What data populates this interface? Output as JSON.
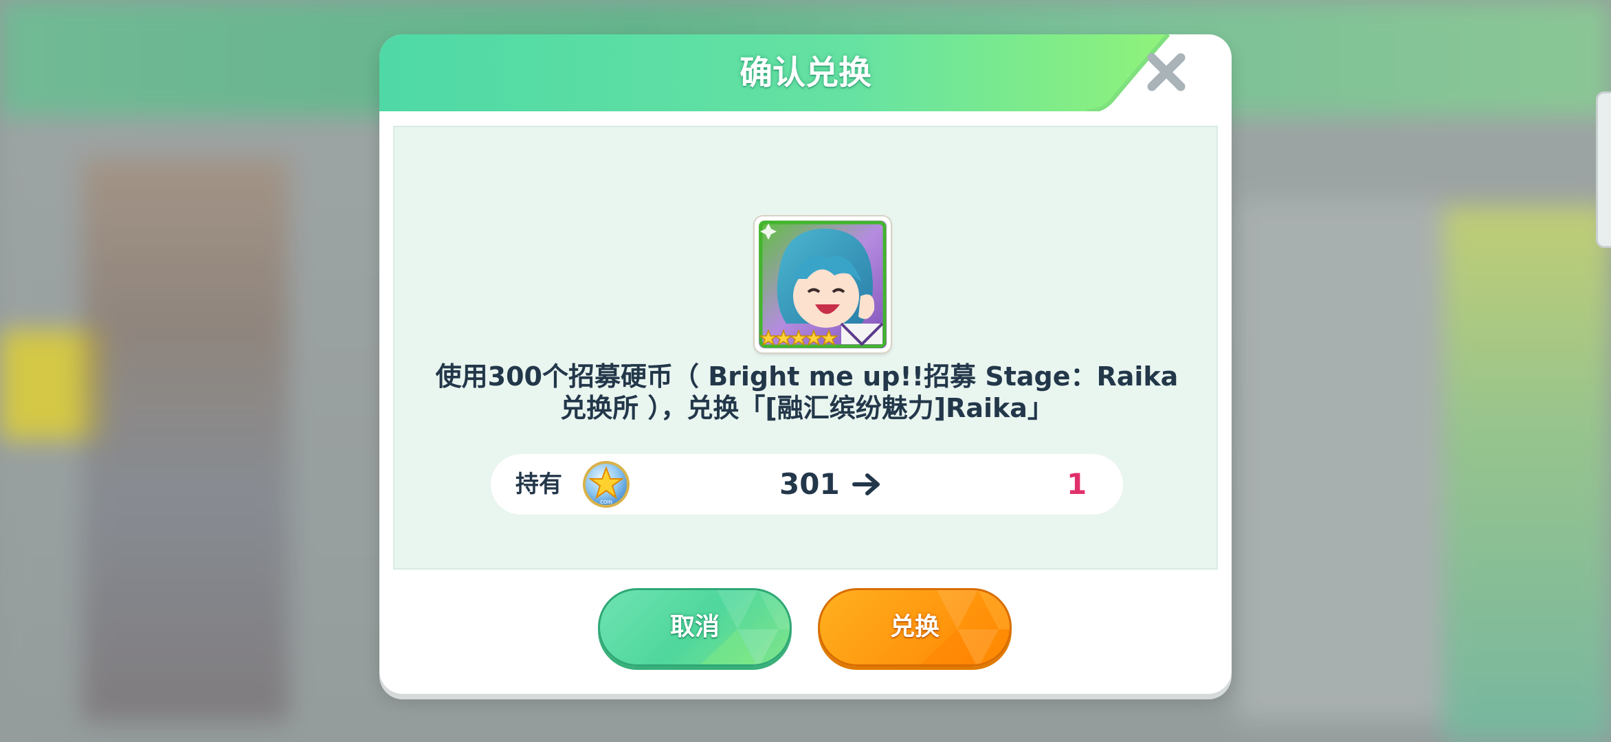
{
  "dialog": {
    "title": "确认兑换",
    "message": "使用300个招募硬币（ Bright me up!!招募 Stage：Raika 兑换所 ），兑换「[融汇缤纷魅力]Raika」",
    "card_icon": "character-card-raika",
    "card_rarity_stars": 5,
    "owned": {
      "label": "持有",
      "coin_icon": "recruit-coin-star-icon",
      "current": "301",
      "after": "1"
    },
    "cancel_label": "取消",
    "confirm_label": "兑换"
  },
  "colors": {
    "header_green": "#5fe0a9",
    "confirm_orange": "#ff9a10",
    "cancel_green": "#4fd79d",
    "after_value_pink": "#e0306a",
    "text_dark": "#23374a"
  }
}
